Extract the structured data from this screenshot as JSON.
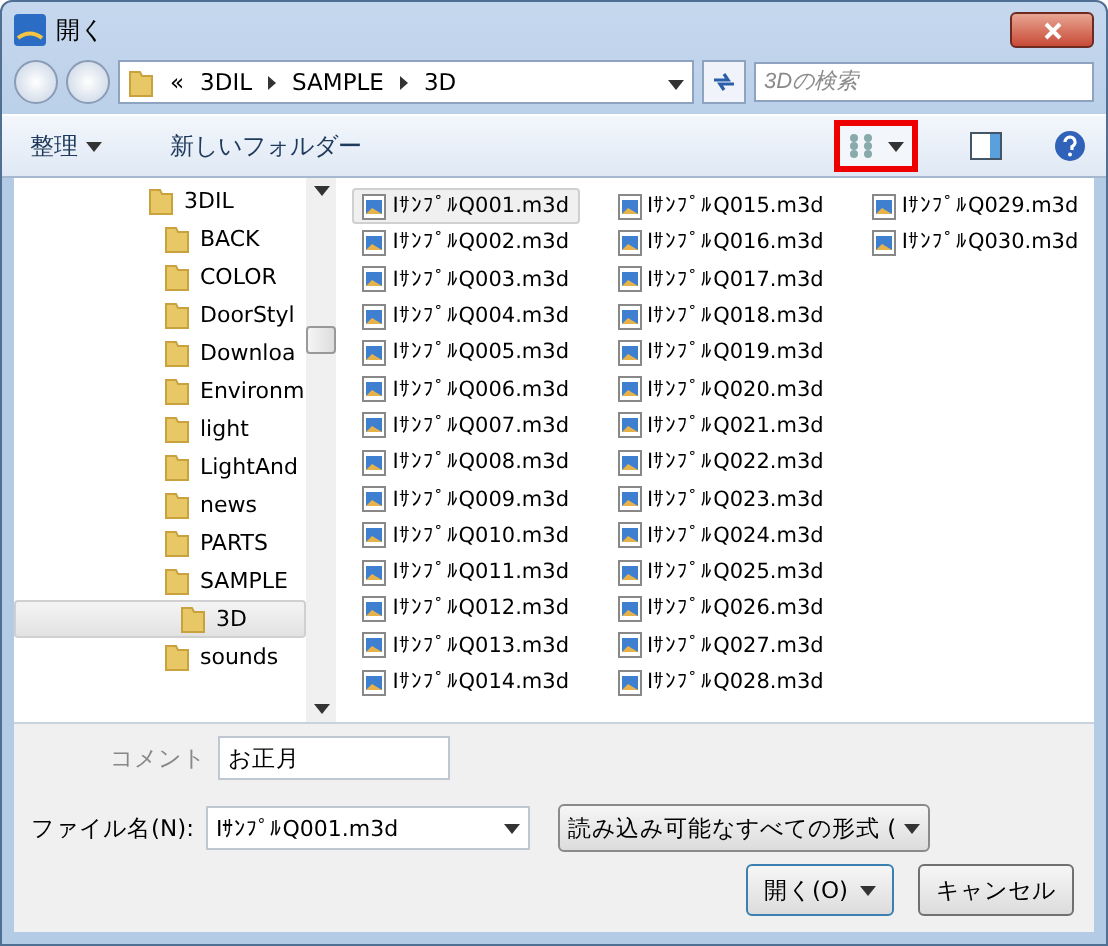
{
  "window": {
    "title": "開く"
  },
  "address": {
    "overflow": "«",
    "crumbs": [
      "3DIL",
      "SAMPLE",
      "3D"
    ]
  },
  "search": {
    "placeholder": "3Dの検索"
  },
  "toolbar": {
    "organize": "整理",
    "new_folder": "新しいフォルダー"
  },
  "tree": [
    {
      "label": "3DIL",
      "selected": false,
      "children": [
        {
          "label": "BACK",
          "selected": false
        },
        {
          "label": "COLOR",
          "selected": false
        },
        {
          "label": "DoorStyl",
          "selected": false
        },
        {
          "label": "Downloa",
          "selected": false
        },
        {
          "label": "Environm",
          "selected": false
        },
        {
          "label": "light",
          "selected": false
        },
        {
          "label": "LightAnd",
          "selected": false
        },
        {
          "label": "news",
          "selected": false
        },
        {
          "label": "PARTS",
          "selected": false
        },
        {
          "label": "SAMPLE",
          "selected": false,
          "children": [
            {
              "label": "3D",
              "selected": true
            }
          ]
        },
        {
          "label": "sounds",
          "selected": false
        }
      ]
    }
  ],
  "files": [
    {
      "name": "IｻﾝﾌﾟﾙQ001.m3d",
      "selected": true
    },
    {
      "name": "IｻﾝﾌﾟﾙQ002.m3d",
      "selected": false
    },
    {
      "name": "IｻﾝﾌﾟﾙQ003.m3d",
      "selected": false
    },
    {
      "name": "IｻﾝﾌﾟﾙQ004.m3d",
      "selected": false
    },
    {
      "name": "IｻﾝﾌﾟﾙQ005.m3d",
      "selected": false
    },
    {
      "name": "IｻﾝﾌﾟﾙQ006.m3d",
      "selected": false
    },
    {
      "name": "IｻﾝﾌﾟﾙQ007.m3d",
      "selected": false
    },
    {
      "name": "IｻﾝﾌﾟﾙQ008.m3d",
      "selected": false
    },
    {
      "name": "IｻﾝﾌﾟﾙQ009.m3d",
      "selected": false
    },
    {
      "name": "IｻﾝﾌﾟﾙQ010.m3d",
      "selected": false
    },
    {
      "name": "IｻﾝﾌﾟﾙQ011.m3d",
      "selected": false
    },
    {
      "name": "IｻﾝﾌﾟﾙQ012.m3d",
      "selected": false
    },
    {
      "name": "IｻﾝﾌﾟﾙQ013.m3d",
      "selected": false
    },
    {
      "name": "IｻﾝﾌﾟﾙQ014.m3d",
      "selected": false
    },
    {
      "name": "IｻﾝﾌﾟﾙQ015.m3d",
      "selected": false
    },
    {
      "name": "IｻﾝﾌﾟﾙQ016.m3d",
      "selected": false
    },
    {
      "name": "IｻﾝﾌﾟﾙQ017.m3d",
      "selected": false
    },
    {
      "name": "IｻﾝﾌﾟﾙQ018.m3d",
      "selected": false
    },
    {
      "name": "IｻﾝﾌﾟﾙQ019.m3d",
      "selected": false
    },
    {
      "name": "IｻﾝﾌﾟﾙQ020.m3d",
      "selected": false
    },
    {
      "name": "IｻﾝﾌﾟﾙQ021.m3d",
      "selected": false
    },
    {
      "name": "IｻﾝﾌﾟﾙQ022.m3d",
      "selected": false
    },
    {
      "name": "IｻﾝﾌﾟﾙQ023.m3d",
      "selected": false
    },
    {
      "name": "IｻﾝﾌﾟﾙQ024.m3d",
      "selected": false
    },
    {
      "name": "IｻﾝﾌﾟﾙQ025.m3d",
      "selected": false
    },
    {
      "name": "IｻﾝﾌﾟﾙQ026.m3d",
      "selected": false
    },
    {
      "name": "IｻﾝﾌﾟﾙQ027.m3d",
      "selected": false
    },
    {
      "name": "IｻﾝﾌﾟﾙQ028.m3d",
      "selected": false
    },
    {
      "name": "IｻﾝﾌﾟﾙQ029.m3d",
      "selected": false
    },
    {
      "name": "IｻﾝﾌﾟﾙQ030.m3d",
      "selected": false
    }
  ],
  "comment": {
    "label": "コメント",
    "value": "お正月"
  },
  "filename": {
    "label": "ファイル名(N):",
    "value": "IｻﾝﾌﾟﾙQ001.m3d"
  },
  "filetype": {
    "value": "読み込み可能なすべての形式 ("
  },
  "buttons": {
    "open": "開く(O)",
    "cancel": "キャンセル"
  }
}
